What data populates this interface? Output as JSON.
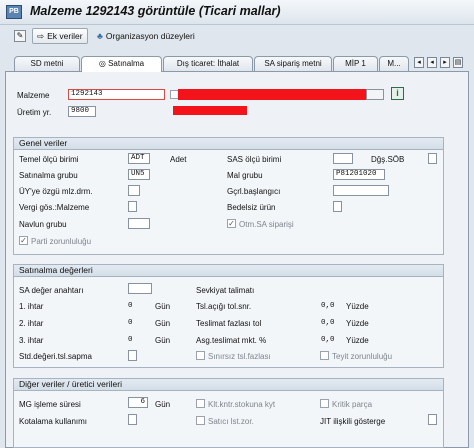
{
  "title": "Malzeme 1292143 görüntüle (Ticari mallar)",
  "toolbar": {
    "ek_veriler": "Ek veriler",
    "org": "Organizasyon düzeyleri"
  },
  "tabs": [
    "SD metni",
    "Satınalma",
    "Dış ticaret: İthalat",
    "SA sipariş metni",
    "MİP 1",
    "M..."
  ],
  "header": {
    "malzeme_label": "Malzeme",
    "malzeme_value": "1292143",
    "uretim_label": "Üretim yr.",
    "uretim_value": "9800"
  },
  "genel": {
    "title": "Genel veriler",
    "temel_label": "Temel ölçü birimi",
    "temel_value": "ADT",
    "temel_text": "Adet",
    "sas_label": "SAS ölçü birimi",
    "dgs_label": "Dğş.SÖB",
    "sat_grubu_label": "Satınalma grubu",
    "sat_grubu_value": "UN5",
    "mal_grubu_label": "Mal grubu",
    "mal_grubu_value": "P81201020",
    "uye_label": "ÜY'ye özgü mlz.drm.",
    "gcr_label": "Gçrl.başlangıcı",
    "vergi_label": "Vergi gös.:Malzeme",
    "bedelsiz_label": "Bedelsiz ürün",
    "navlun_label": "Navlun grubu",
    "otm_label": "Otm.SA siparişi",
    "parti_label": "Parti zorunluluğu"
  },
  "satinalma": {
    "title": "Satınalma değerleri",
    "sa_label": "SA değer anahtarı",
    "sevk_label": "Sevkiyat talimatı",
    "ihtar1_label": "1. ihtar",
    "ihtar1_value": "0",
    "ihtar1_unit": "Gün",
    "ihtar2_label": "2. ihtar",
    "ihtar2_value": "0",
    "ihtar2_unit": "Gün",
    "ihtar3_label": "3. ihtar",
    "ihtar3_value": "0",
    "ihtar3_unit": "Gün",
    "std_label": "Std.değeri.tsl.sapma",
    "tsl_label": "Tsl.açığı tol.snr.",
    "tsl_value": "0,0",
    "tsl_unit": "Yüzde",
    "tes_label": "Teslimat fazlası tol",
    "tes_value": "0,0",
    "tes_unit": "Yüzde",
    "asg_label": "Asg.teslimat mkt. %",
    "asg_value": "0,0",
    "asg_unit": "Yüzde",
    "sinirsiz_label": "Sınırsız tsl.fazlası",
    "teyit_label": "Teyit zorunluluğu"
  },
  "diger": {
    "title": "Diğer veriler / üretici verileri",
    "mg_label": "MG işleme süresi",
    "mg_value": "6",
    "mg_unit": "Gün",
    "klt_label": "Klt.kntr.stokuna kyt",
    "kritik_label": "Kritik parça",
    "kota_label": "Kotalama kullanımı",
    "satici_label": "Satıcı lst.zor.",
    "jit_label": "JIT ilişkili gösterge"
  }
}
